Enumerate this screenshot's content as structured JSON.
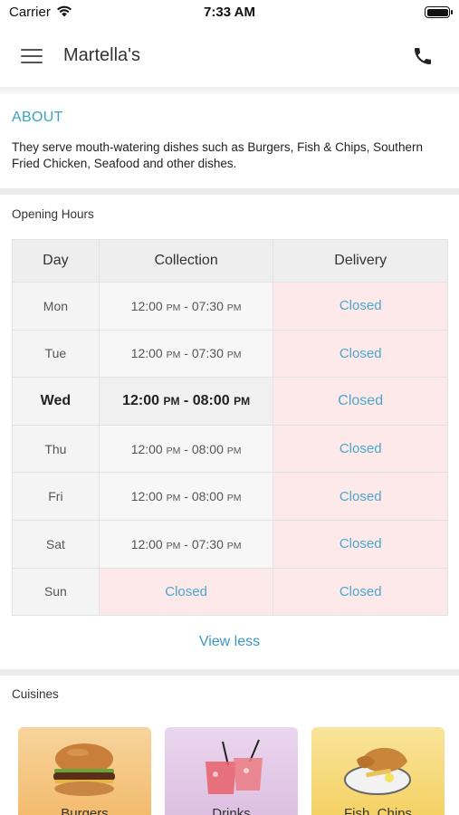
{
  "status_bar": {
    "carrier": "Carrier",
    "time": "7:33 AM"
  },
  "nav": {
    "title": "Martella's",
    "menu_icon": "hamburger-menu-icon",
    "call_icon": "phone-icon"
  },
  "about": {
    "title": "ABOUT",
    "text": "They serve mouth-watering dishes such as Burgers, Fish & Chips, Southern Fried Chicken, Seafood and other dishes."
  },
  "hours": {
    "title": "Opening Hours",
    "headers": {
      "day": "Day",
      "collection": "Collection",
      "delivery": "Delivery"
    },
    "rows": [
      {
        "day": "Mon",
        "collection": "12:00 PM - 07:30 PM",
        "delivery": "Closed"
      },
      {
        "day": "Tue",
        "collection": "12:00 PM - 07:30 PM",
        "delivery": "Closed"
      },
      {
        "day": "Wed",
        "collection": "12:00 PM - 08:00 PM",
        "delivery": "Closed"
      },
      {
        "day": "Thu",
        "collection": "12:00 PM - 08:00 PM",
        "delivery": "Closed"
      },
      {
        "day": "Fri",
        "collection": "12:00 PM - 08:00 PM",
        "delivery": "Closed"
      },
      {
        "day": "Sat",
        "collection": "12:00 PM - 07:30 PM",
        "delivery": "Closed"
      },
      {
        "day": "Sun",
        "collection": "Closed",
        "delivery": "Closed"
      }
    ],
    "view_less": "View less"
  },
  "cuisines": {
    "title": "Cuisines",
    "items": [
      {
        "label": "Burgers",
        "icon": "burger-icon",
        "color": "#f6c98a"
      },
      {
        "label": "Drinks",
        "icon": "cocktail-icon",
        "color": "#e4c9e6"
      },
      {
        "label": "Fish, Chips",
        "icon": "fish-and-chips-icon",
        "color": "#f7dc7a"
      }
    ]
  },
  "colors": {
    "accent": "#3aa0c8",
    "closed_bg": "#fde8ea"
  }
}
